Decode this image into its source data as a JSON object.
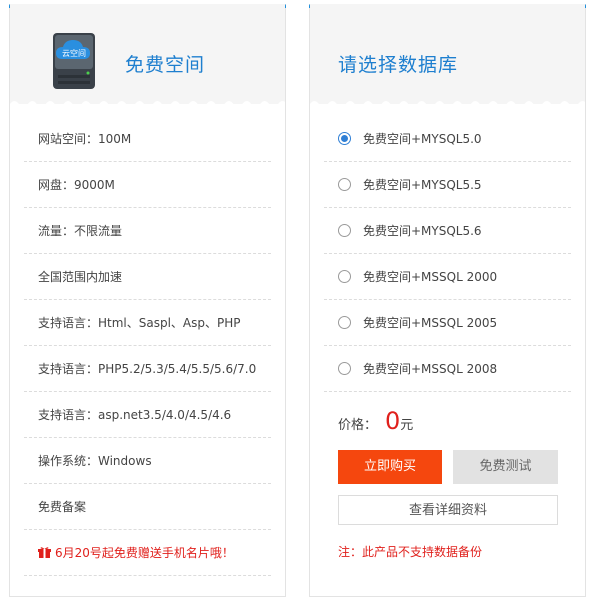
{
  "left": {
    "title": "免费空间",
    "server_label": "云空间",
    "specs": [
      "网站空间：100M",
      "网盘：9000M",
      "流量：不限流量",
      "全国范围内加速",
      "支持语言：Html、Saspl、Asp、PHP",
      "支持语言：PHP5.2/5.3/5.4/5.5/5.6/7.0",
      "支持语言：asp.net3.5/4.0/4.5/4.6",
      "操作系统：Windows",
      "免费备案"
    ],
    "promo": "6月20号起免费赠送手机名片哦！"
  },
  "right": {
    "title": "请选择数据库",
    "options": [
      {
        "label": "免费空间+MYSQL5.0",
        "checked": true
      },
      {
        "label": "免费空间+MYSQL5.5",
        "checked": false
      },
      {
        "label": "免费空间+MYSQL5.6",
        "checked": false
      },
      {
        "label": "免费空间+MSSQL 2000",
        "checked": false
      },
      {
        "label": "免费空间+MSSQL 2005",
        "checked": false
      },
      {
        "label": "免费空间+MSSQL 2008",
        "checked": false
      }
    ],
    "price_label": "价格：",
    "price_value": "0",
    "price_unit": "元",
    "buy_label": "立即购买",
    "trial_label": "免费测试",
    "detail_label": "查看详细资料",
    "note": "注：此产品不支持数据备份"
  },
  "colors": {
    "accent_blue": "#1e8fdc",
    "title_blue": "#1e7fcf",
    "buy_orange": "#f5470e",
    "alert_red": "#e0201c",
    "radio_blue": "#2f7fd5"
  },
  "icons": {
    "server": "server-icon",
    "gift": "gift-icon"
  }
}
